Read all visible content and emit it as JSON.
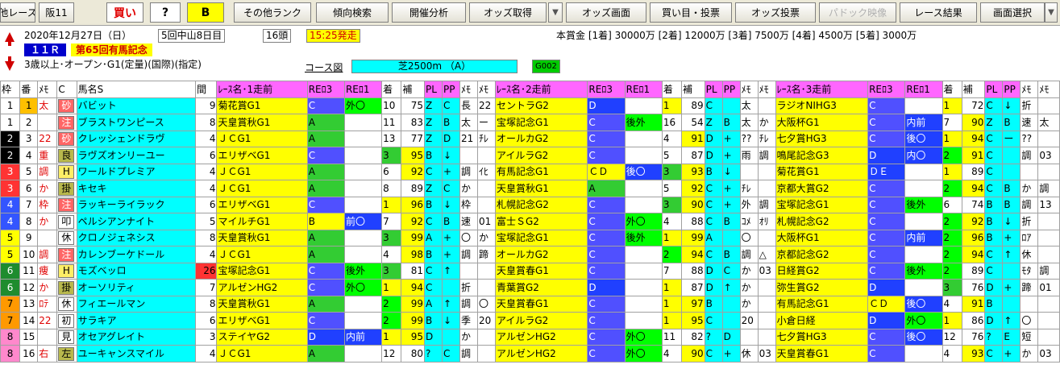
{
  "toolbar": {
    "items": [
      "他レース",
      "阪11",
      "買い",
      "?",
      "B",
      "その他ランク",
      "傾向検索",
      "開催分析",
      "オッズ取得",
      "▼",
      "オッズ画面",
      "買い目・投票",
      "オッズ投票",
      "パドック映像",
      "レース結果",
      "画面選択",
      "▼"
    ]
  },
  "race": {
    "date": "2020年12月27日（日）",
    "meeting": "5回中山8日目",
    "heads": "16頭",
    "start": "15:25発走",
    "prize": "本賞金 [1着] 30000万 [2着] 12000万 [3着] 7500万 [4着] 4500万 [5着] 3000万",
    "raceno": "１１Ｒ",
    "name": "第65回有馬記念",
    "cond": "3歳以上･オープン･G1(定量)(国際)(指定)",
    "course_label": "コース図",
    "course": "芝2500m （A）",
    "code": "G002"
  },
  "headers": [
    "枠",
    "番",
    "ﾒﾓ",
    "C",
    "馬名S",
    "間",
    "ﾚｰｽ名･1走前",
    "REﾛ3",
    "REﾛ1",
    "着",
    "補",
    "PL",
    "PP",
    "ﾒﾓ",
    "ﾒﾓ",
    "ﾚｰｽ名･2走前",
    "REﾛ3",
    "REﾛ1",
    "着",
    "補",
    "PL",
    "PP",
    "ﾒﾓ",
    "ﾒﾓ",
    "ﾚｰｽ名･3走前",
    "REﾛ3",
    "REﾛ1",
    "着",
    "補",
    "PL",
    "PP",
    "ﾒﾓ",
    "ﾒﾓ"
  ],
  "rows": [
    {
      "w": "1",
      "n": "1",
      "m": "太",
      "mark": "砂",
      "name": "バビット",
      "k": "9",
      "r1": [
        "菊花賞G1",
        "C",
        "外〇",
        "10",
        "75",
        "Z",
        "C",
        "長",
        "22"
      ],
      "r2": [
        "セントラG2",
        "D",
        "",
        "1",
        "89",
        "C",
        "",
        "太",
        ""
      ],
      "r3": [
        "ラジオNIHG3",
        "C",
        "",
        "1",
        "72",
        "C",
        "↓",
        "折",
        ""
      ]
    },
    {
      "w": "1",
      "n": "2",
      "m": "",
      "mark": "注",
      "name": "ブラストワンピース",
      "k": "8",
      "r1": [
        "天皇賞秋G1",
        "A",
        "",
        "11",
        "83",
        "Z",
        "B",
        "太",
        "ー"
      ],
      "r2": [
        "宝塚記念G1",
        "C",
        "後外",
        "16",
        "54",
        "Z",
        "B",
        "太",
        "か"
      ],
      "r3": [
        "大阪杯G1",
        "C",
        "内前",
        "7",
        "90",
        "Z",
        "B",
        "速",
        "太"
      ]
    },
    {
      "w": "2",
      "n": "3",
      "m": "22",
      "mark": "砂",
      "name": "クレッシェンドラヴ",
      "k": "4",
      "r1": [
        "ＪＣG1",
        "A",
        "",
        "13",
        "77",
        "Z",
        "D",
        "21",
        "ﾁﾚ"
      ],
      "r2": [
        "オールカG2",
        "C",
        "",
        "4",
        "91",
        "D",
        "+",
        "??",
        "ﾁﾚ"
      ],
      "r3": [
        "七夕賞HG3",
        "C",
        "後〇",
        "1",
        "94",
        "C",
        "ー",
        "??",
        ""
      ]
    },
    {
      "w": "2",
      "n": "4",
      "m": "重",
      "mark": "良",
      "name": "ラヴズオンリーユー",
      "k": "6",
      "r1": [
        "エリザベG1",
        "C",
        "",
        "3",
        "95",
        "B",
        "↓",
        "",
        ""
      ],
      "r2": [
        "アイルラG2",
        "C",
        "",
        "5",
        "87",
        "D",
        "+",
        "雨",
        "調"
      ],
      "r3": [
        "鳴尾記念G3",
        "D",
        "内〇",
        "2",
        "91",
        "C",
        "",
        "調",
        "03"
      ]
    },
    {
      "w": "3",
      "n": "5",
      "m": "調",
      "mark": "H",
      "name": "ワールドプレミア",
      "k": "4",
      "r1": [
        "ＪＣG1",
        "A",
        "",
        "6",
        "92",
        "C",
        "+",
        "調",
        "ｲﾋ"
      ],
      "r2": [
        "有馬記念G1",
        "ＣＤ",
        "後〇",
        "3",
        "93",
        "B",
        "↓",
        "",
        ""
      ],
      "r3": [
        "菊花賞G1",
        "ＤＥ",
        "",
        "1",
        "89",
        "C",
        "",
        "",
        ""
      ]
    },
    {
      "w": "3",
      "n": "6",
      "m": "か",
      "mark": "掛",
      "name": "キセキ",
      "k": "4",
      "r1": [
        "ＪＣG1",
        "A",
        "",
        "8",
        "89",
        "Z",
        "C",
        "か",
        ""
      ],
      "r2": [
        "天皇賞秋G1",
        "A",
        "",
        "5",
        "92",
        "C",
        "+",
        "ﾁﾚ",
        ""
      ],
      "r3": [
        "京都大賞G2",
        "C",
        "",
        "2",
        "94",
        "C",
        "B",
        "か",
        "調"
      ]
    },
    {
      "w": "4",
      "n": "7",
      "m": "枠",
      "mark": "注",
      "name": "ラッキーライラック",
      "k": "6",
      "r1": [
        "エリザベG1",
        "C",
        "",
        "1",
        "96",
        "B",
        "↓",
        "枠",
        ""
      ],
      "r2": [
        "札幌記念G2",
        "C",
        "",
        "3",
        "90",
        "C",
        "+",
        "外",
        "調"
      ],
      "r3": [
        "宝塚記念G1",
        "C",
        "後外",
        "6",
        "74",
        "B",
        "B",
        "調",
        "13"
      ]
    },
    {
      "w": "4",
      "n": "8",
      "m": "か",
      "mark": "叩",
      "name": "ペルシアンナイト",
      "k": "5",
      "r1": [
        "マイルチG1",
        "B",
        "前〇",
        "7",
        "92",
        "C",
        "B",
        "速",
        "01"
      ],
      "r2": [
        "富士ＳG2",
        "C",
        "外〇",
        "4",
        "88",
        "C",
        "B",
        "ｺﾒ",
        "ｵﾘ"
      ],
      "r3": [
        "札幌記念G2",
        "C",
        "",
        "2",
        "92",
        "B",
        "↓",
        "折",
        ""
      ]
    },
    {
      "w": "5",
      "n": "9",
      "m": "",
      "mark": "休",
      "name": "クロノジェネシス",
      "k": "8",
      "r1": [
        "天皇賞秋G1",
        "A",
        "",
        "3",
        "99",
        "A",
        "+",
        "〇",
        "か"
      ],
      "r2": [
        "宝塚記念G1",
        "C",
        "後外",
        "1",
        "99",
        "A",
        "",
        "〇",
        ""
      ],
      "r3": [
        "大阪杯G1",
        "C",
        "内前",
        "2",
        "96",
        "B",
        "+",
        "ﾛｱ",
        ""
      ]
    },
    {
      "w": "5",
      "n": "10",
      "m": "調",
      "mark": "注",
      "name": "カレンブーケドール",
      "k": "4",
      "r1": [
        "ＪＣG1",
        "A",
        "",
        "4",
        "98",
        "B",
        "+",
        "調",
        "蹄"
      ],
      "r2": [
        "オールカG2",
        "C",
        "",
        "2",
        "94",
        "C",
        "B",
        "調",
        "△"
      ],
      "r3": [
        "京都記念G2",
        "C",
        "",
        "2",
        "94",
        "C",
        "↑",
        "休",
        ""
      ]
    },
    {
      "w": "6",
      "n": "11",
      "m": "痩",
      "mark": "H",
      "name": "モズベッロ",
      "k": "26",
      "r1": [
        "宝塚記念G1",
        "C",
        "後外",
        "3",
        "81",
        "C",
        "↑",
        "",
        ""
      ],
      "r2": [
        "天皇賞春G1",
        "C",
        "",
        "7",
        "88",
        "D",
        "C",
        "か",
        "03"
      ],
      "r3": [
        "日経賞G2",
        "C",
        "後外",
        "2",
        "89",
        "C",
        "",
        "ﾓﾀ",
        "調"
      ]
    },
    {
      "w": "6",
      "n": "12",
      "m": "か",
      "mark": "掛",
      "name": "オーソリティ",
      "k": "7",
      "r1": [
        "アルゼンHG2",
        "C",
        "外〇",
        "1",
        "94",
        "C",
        "",
        "折",
        ""
      ],
      "r2": [
        "青葉賞G2",
        "D",
        "",
        "1",
        "87",
        "D",
        "↑",
        "か",
        ""
      ],
      "r3": [
        "弥生賞G2",
        "D",
        "",
        "3",
        "76",
        "D",
        "+",
        "蹄",
        "01"
      ]
    },
    {
      "w": "7",
      "n": "13",
      "m": "ﾛﾃ",
      "mark": "休",
      "name": "フィエールマン",
      "k": "8",
      "r1": [
        "天皇賞秋G1",
        "A",
        "",
        "2",
        "99",
        "A",
        "↑",
        "調",
        "〇"
      ],
      "r2": [
        "天皇賞春G1",
        "C",
        "",
        "1",
        "97",
        "B",
        "",
        "か",
        ""
      ],
      "r3": [
        "有馬記念G1",
        "ＣＤ",
        "後〇",
        "4",
        "91",
        "B",
        "",
        "",
        ""
      ]
    },
    {
      "w": "7",
      "n": "14",
      "m": "22",
      "mark": "初",
      "name": "サラキア",
      "k": "6",
      "r1": [
        "エリザベG1",
        "C",
        "",
        "2",
        "99",
        "B",
        "↓",
        "季",
        "20"
      ],
      "r2": [
        "アイルラG2",
        "C",
        "",
        "1",
        "95",
        "C",
        "",
        "20",
        ""
      ],
      "r3": [
        "小倉日経",
        "D",
        "外〇",
        "1",
        "86",
        "D",
        "↑",
        "〇",
        ""
      ]
    },
    {
      "w": "8",
      "n": "15",
      "m": "",
      "mark": "見",
      "name": "オセアグレイト",
      "k": "3",
      "r1": [
        "ステイヤG2",
        "D",
        "内前",
        "1",
        "95",
        "D",
        "",
        "か",
        ""
      ],
      "r2": [
        "アルゼンHG2",
        "C",
        "外〇",
        "11",
        "82",
        "?",
        "D",
        "",
        ""
      ],
      "r3": [
        "七夕賞HG3",
        "C",
        "後〇",
        "12",
        "76",
        "?",
        "E",
        "短",
        ""
      ]
    },
    {
      "w": "8",
      "n": "16",
      "m": "右",
      "mark": "左",
      "name": "ユーキャンスマイル",
      "k": "4",
      "r1": [
        "ＪＣG1",
        "A",
        "",
        "12",
        "80",
        "?",
        "C",
        "調",
        ""
      ],
      "r2": [
        "アルゼンHG2",
        "C",
        "外〇",
        "4",
        "90",
        "C",
        "+",
        "休",
        "03"
      ],
      "r3": [
        "天皇賞春G1",
        "C",
        "",
        "4",
        "93",
        "C",
        "+",
        "か",
        "03"
      ]
    }
  ]
}
